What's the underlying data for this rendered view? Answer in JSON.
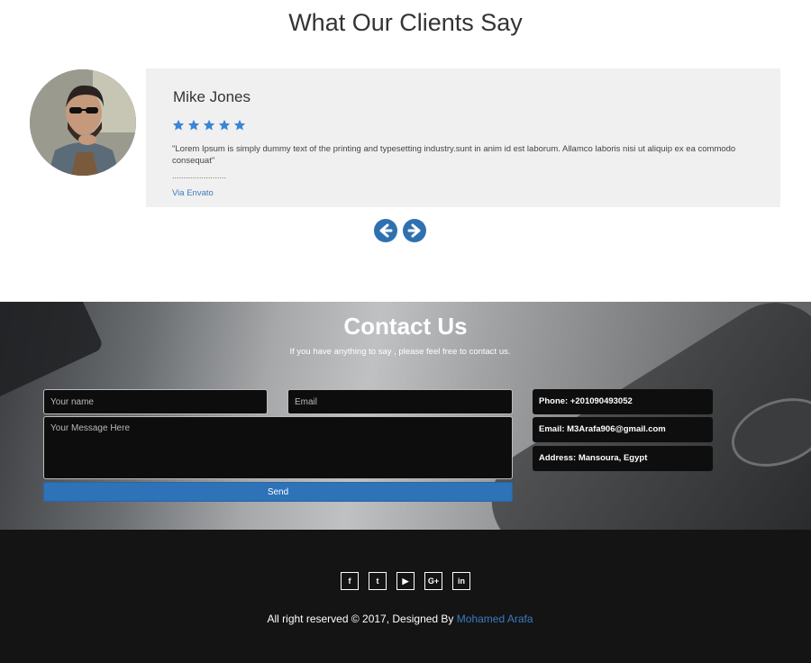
{
  "testimonials": {
    "title": "What Our Clients Say",
    "name": "Mike Jones",
    "rating": 5,
    "quote": "\"Lorem Ipsum is simply dummy text of the printing and typesetting industry.sunt in anim id est laborum. Allamco laboris nisi ut aliquip ex ea commodo consequat\"",
    "dots": "........................",
    "source_link": "Via Envato",
    "star_color": "#3a86d6",
    "prev_icon": "arrow-left-circle-icon",
    "next_icon": "arrow-right-circle-icon"
  },
  "contact": {
    "title": "Contact Us",
    "subtitle": "If you have anything to say , please feel free to contact us.",
    "name_placeholder": "Your name",
    "email_placeholder": "Email",
    "message_placeholder": "Your Message Here",
    "send_label": "Send",
    "phone": "Phone: +201090493052",
    "email": "Email: M3Arafa906@gmail.com",
    "address": "Address: Mansoura, Egypt",
    "accent": "#2e72b8"
  },
  "footer": {
    "socials": [
      {
        "icon": "facebook-icon",
        "glyph": "f"
      },
      {
        "icon": "twitter-icon",
        "glyph": "t"
      },
      {
        "icon": "youtube-icon",
        "glyph": "▶"
      },
      {
        "icon": "google-plus-icon",
        "glyph": "G+"
      },
      {
        "icon": "linkedin-icon",
        "glyph": "in"
      }
    ],
    "copyright": "All right reserved © 2017, Designed By",
    "author": "Mohamed Arafa",
    "background": "#141414"
  }
}
